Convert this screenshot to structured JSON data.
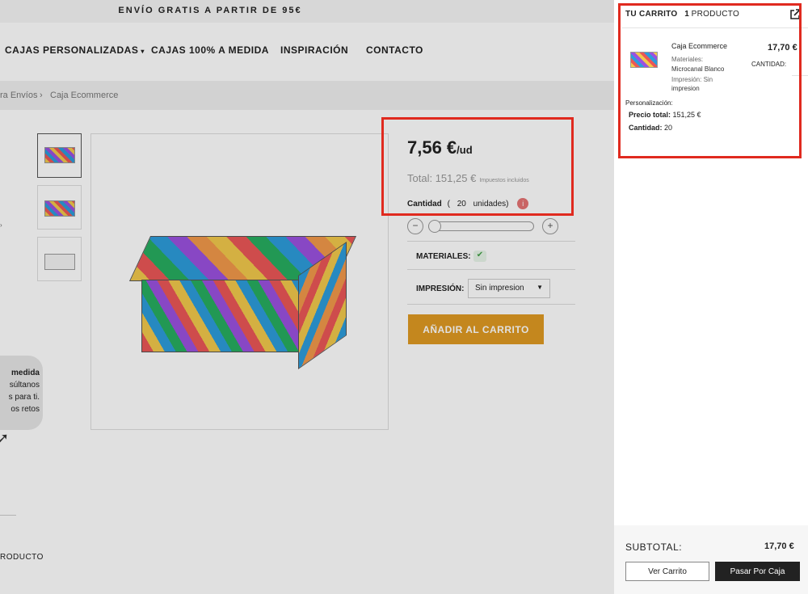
{
  "topbar": {
    "text": "ENVÍO GRATIS A PARTIR DE 95€"
  },
  "nav": {
    "items": [
      "CAJAS PERSONALIZADAS",
      "CAJAS 100% A MEDIDA",
      "INSPIRACIÓN",
      "CONTACTO"
    ],
    "caret": "▾"
  },
  "breadcrumb": {
    "items": [
      "ra Envíos",
      "Caja Ecommerce"
    ],
    "separator": "›"
  },
  "product": {
    "price": "7,56 €",
    "price_unit": "/ud",
    "total_label": "Total:",
    "total_value": "151,25 €",
    "tax_note": "Impuestos incluidos",
    "qty_label": "Cantidad",
    "qty_open": "(",
    "qty_value": "20",
    "qty_unit": "unidades)",
    "info": "i",
    "minus": "−",
    "plus": "+",
    "quantity_fraction": 0,
    "materials_label": "MATERIALES:",
    "check": "✔",
    "printing_label": "IMPRESIÓN:",
    "printing_value": "Sin impresion",
    "add_to_cart": "AÑADIR AL CARRITO"
  },
  "promo": {
    "lines": [
      "medida",
      "súltanos",
      "s para ti.",
      "os retos"
    ]
  },
  "footer": {
    "text": "RODUCTO"
  },
  "cart": {
    "title": "TU CARRITO",
    "count": "1",
    "count_label": "PRODUCTO",
    "item": {
      "name": "Caja Ecommerce",
      "price": "17,70 €",
      "qty_label": "CANTIDAD:",
      "materials_label": "Materiales:",
      "materials_value": "Microcanal Blanco",
      "printing_line1": "Impresión: Sin",
      "printing_line2": "impresion",
      "personalization": "Personalización:",
      "total_label": "Precio total:",
      "total_value": "151,25 €",
      "qty_label2": "Cantidad:",
      "qty_value": "20"
    },
    "subtotal_label": "SUBTOTAL:",
    "subtotal_value": "17,70 €",
    "view_cart": "Ver Carrito",
    "checkout": "Pasar Por Caja"
  },
  "icons": {
    "external": "external-link-icon",
    "cursor": "cursor-icon",
    "check": "check-icon"
  },
  "colors": {
    "accent": "#e09a23",
    "highlight": "#e02a1f",
    "dark_button": "#222222"
  }
}
